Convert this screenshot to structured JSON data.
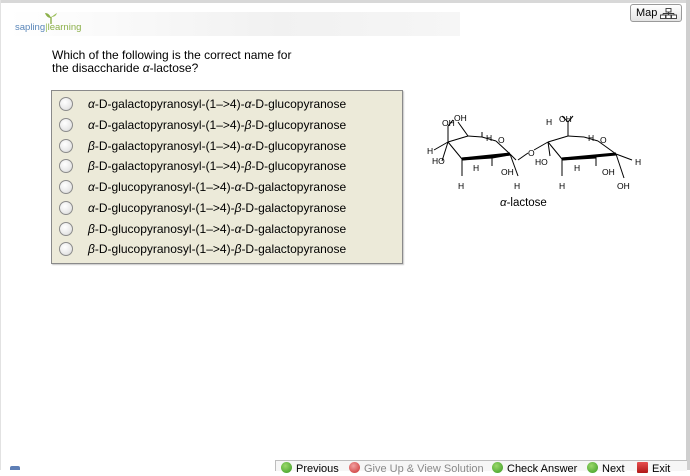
{
  "brand": {
    "part1": "sapling",
    "separator": "|",
    "part2": "learning"
  },
  "map_button": {
    "label": "Map"
  },
  "question": {
    "line1": "Which of the following is the correct name for",
    "line2_prefix": "the disaccharide ",
    "line2_symbol": "α",
    "line2_suffix": "-lactose?"
  },
  "options": [
    {
      "a": "α",
      "mid": "-D-galactopyranosyl-(1–>4)-",
      "b": "α",
      "end": "-D-glucopyranose"
    },
    {
      "a": "α",
      "mid": "-D-galactopyranosyl-(1–>4)-",
      "b": "β",
      "end": "-D-glucopyranose"
    },
    {
      "a": "β",
      "mid": "-D-galactopyranosyl-(1–>4)-",
      "b": "α",
      "end": "-D-glucopyranose"
    },
    {
      "a": "β",
      "mid": "-D-galactopyranosyl-(1–>4)-",
      "b": "β",
      "end": "-D-glucopyranose"
    },
    {
      "a": "α",
      "mid": "-D-glucopyranosyl-(1–>4)-",
      "b": "α",
      "end": "-D-galactopyranose"
    },
    {
      "a": "α",
      "mid": "-D-glucopyranosyl-(1–>4)-",
      "b": "β",
      "end": "-D-galactopyranose"
    },
    {
      "a": "β",
      "mid": "-D-glucopyranosyl-(1–>4)-",
      "b": "α",
      "end": "-D-galactopyranose"
    },
    {
      "a": "β",
      "mid": "-D-glucopyranosyl-(1–>4)-",
      "b": "β",
      "end": "-D-galactopyranose"
    }
  ],
  "structure": {
    "atoms": {
      "oh_top_left": "OH",
      "oh_top_left2": "OH",
      "h_left": "H",
      "ho_left": "HO",
      "h_ring1": "H",
      "o_ring1": "O",
      "h_bottom1": "H",
      "oh_bottom1": "OH",
      "h_bottom1b": "H",
      "h_mid1": "H",
      "o_link": "O",
      "h_top2": "H",
      "oh_top2": "OH",
      "h_ring2": "H",
      "o_ring2": "O",
      "ho_mid2": "HO",
      "h_mid2": "H",
      "h_bottom2": "H",
      "oh_right": "OH",
      "h_right": "H",
      "oh_bottom2": "OH"
    },
    "caption_symbol": "α",
    "caption_text": "-lactose"
  },
  "nav": {
    "previous": "Previous",
    "give_up": "Give Up & View Solution",
    "check": "Check Answer",
    "next": "Next",
    "exit": "Exit"
  },
  "colors": {
    "option_panel": "#ecead9",
    "brand_blue": "#5a86b9",
    "brand_green": "#8cb04a"
  }
}
